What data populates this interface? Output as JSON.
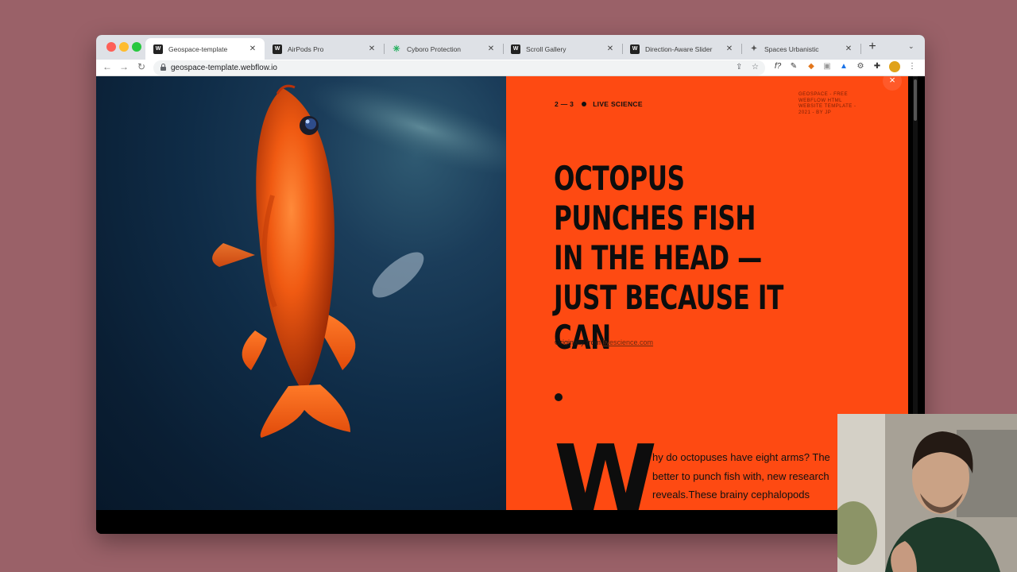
{
  "browser": {
    "tabs": [
      {
        "label": "Geospace-template",
        "favicon": "W",
        "active": true
      },
      {
        "label": "AirPods Pro",
        "favicon": "W",
        "active": false
      },
      {
        "label": "Cyboro Protection",
        "favicon": "✳",
        "active": false
      },
      {
        "label": "Scroll Gallery",
        "favicon": "W",
        "active": false
      },
      {
        "label": "Direction-Aware Slider",
        "favicon": "W",
        "active": false
      },
      {
        "label": "Spaces Urbanistic",
        "favicon": "✦",
        "active": false
      }
    ],
    "url": "geospace-template.webflow.io",
    "new_tab_label": "+",
    "tab_close_label": "✕"
  },
  "article": {
    "kicker_counter": "2 — 3",
    "kicker_source": "LIVE SCIENCE",
    "corner_note": "GEOSPACE - FREE WEBFLOW HTML WEBSITE TEMPLATE - 2021 - BY JP",
    "headline": "OCTOPUS PUNCHES FISH IN THE HEAD —JUST BECAUSE IT CAN",
    "source_prefix": "Originally from",
    "source_link": "livescience.com",
    "dropcap": "W",
    "body": "hy do octopuses have eight arms? The better to punch fish with, new research reveals.These brainy cephalopods",
    "close_label": "×"
  },
  "colors": {
    "panel_bg": "#fe4a12",
    "page_bg": "#9a6168",
    "text_dark": "#0d0d0d"
  },
  "icons": {
    "back": "arrow-left-icon",
    "forward": "arrow-right-icon",
    "reload": "reload-icon",
    "lock": "lock-icon",
    "share": "share-icon",
    "bookmark": "star-icon",
    "menu": "kebab-menu-icon"
  }
}
